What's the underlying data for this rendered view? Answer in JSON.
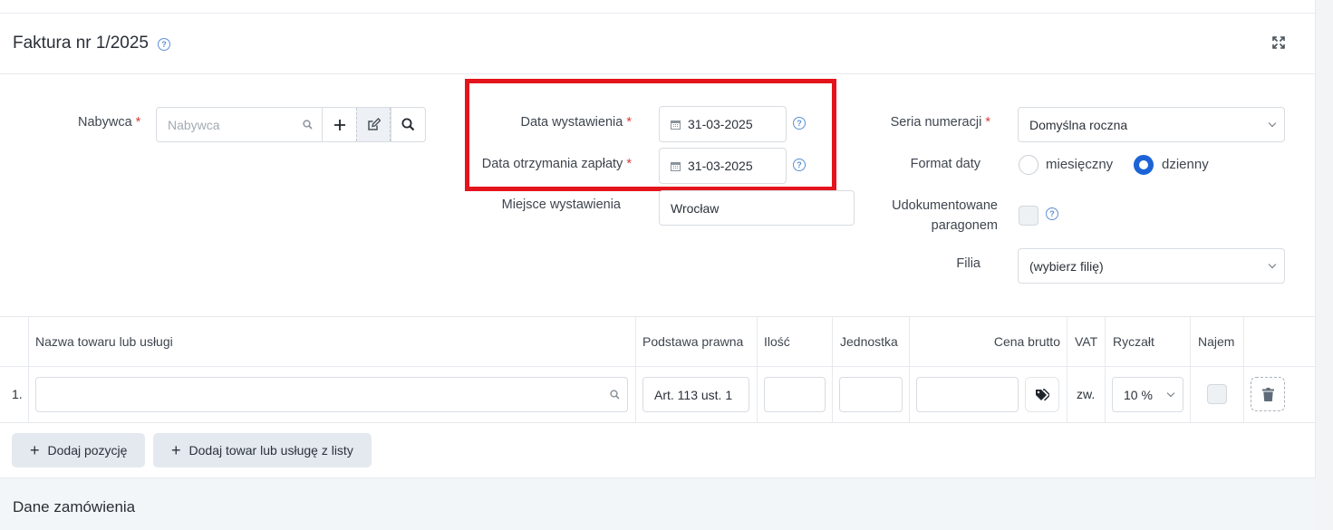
{
  "header": {
    "title": "Faktura nr 1/2025",
    "help_icon": "question-icon",
    "expand_icon": "expand-icon"
  },
  "buyer": {
    "label": "Nabywca",
    "required_mark": "*",
    "placeholder": "Nabywca",
    "search_icon": "search-icon",
    "add_icon": "plus-icon",
    "edit_icon": "edit-icon",
    "find_icon": "magnifier-icon"
  },
  "dates": {
    "issue_label": "Data wystawienia",
    "issue_value": "31-03-2025",
    "payment_label": "Data otrzymania zapłaty",
    "payment_value": "31-03-2025",
    "required_mark": "*",
    "calendar_icon": "calendar-icon",
    "highlight_color": "#e3141c"
  },
  "place": {
    "label": "Miejsce wystawienia",
    "value": "Wrocław"
  },
  "numbering": {
    "label": "Seria numeracji",
    "required_mark": "*",
    "value": "Domyślna roczna"
  },
  "date_format": {
    "label": "Format daty",
    "options": [
      "miesięczny",
      "dzienny"
    ],
    "selected": "dzienny"
  },
  "receipt": {
    "label_line1": "Udokumentowane",
    "label_line2": "paragonem",
    "checked": false
  },
  "branch": {
    "label": "Filia",
    "value": "(wybierz filię)"
  },
  "table": {
    "headers": {
      "name": "Nazwa towaru lub usługi",
      "legal_basis": "Podstawa prawna",
      "quantity": "Ilość",
      "unit": "Jednostka",
      "gross_price": "Cena brutto",
      "vat": "VAT",
      "flat_rate": "Ryczałt",
      "rent": "Najem"
    },
    "rows": [
      {
        "index": "1.",
        "name": "",
        "legal_basis": "Art. 113 ust. 1",
        "quantity": "",
        "unit": "",
        "gross_price": "",
        "vat": "zw.",
        "flat_rate": "10 %",
        "rent": false
      }
    ]
  },
  "actions": {
    "add_position": "Dodaj pozycję",
    "add_from_list": "Dodaj towar lub usługę z listy"
  },
  "footer": {
    "title": "Dane zamówienia"
  },
  "colors": {
    "accent": "#1c64d6",
    "required": "#d93b3b",
    "button_bg": "#e4e9ef"
  }
}
